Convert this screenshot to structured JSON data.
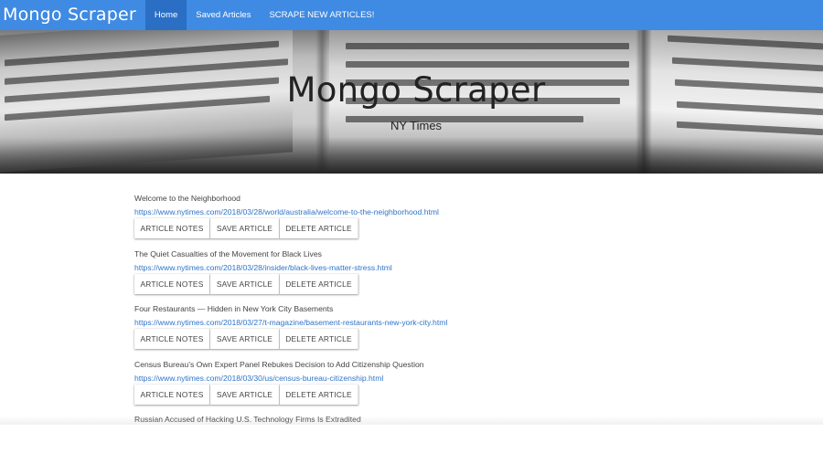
{
  "navbar": {
    "brand": "Mongo Scraper",
    "items": [
      {
        "label": "Home",
        "active": true
      },
      {
        "label": "Saved Articles",
        "active": false
      },
      {
        "label": "SCRAPE NEW ARTICLES!",
        "active": false
      }
    ],
    "color": "#3f8ae2",
    "active_color": "#2a6fc4"
  },
  "hero": {
    "title": "Mongo Scraper",
    "subtitle": "NY Times",
    "background": "newspaper-photo"
  },
  "buttons": {
    "notes": "ARTICLE NOTES",
    "save": "SAVE ARTICLE",
    "delete": "DELETE ARTICLE"
  },
  "articles": [
    {
      "title": "Welcome to the Neighborhood",
      "link": "https://www.nytimes.com/2018/03/28/world/australia/welcome-to-the-neighborhood.html"
    },
    {
      "title": "The Quiet Casualties of the Movement for Black Lives",
      "link": "https://www.nytimes.com/2018/03/28/insider/black-lives-matter-stress.html"
    },
    {
      "title": "Four Restaurants — Hidden in New York City Basements",
      "link": "https://www.nytimes.com/2018/03/27/t-magazine/basement-restaurants-new-york-city.html"
    },
    {
      "title": "Census Bureau’s Own Expert Panel Rebukes Decision to Add Citizenship Question",
      "link": "https://www.nytimes.com/2018/03/30/us/census-bureau-citizenship.html"
    },
    {
      "title": "Russian Accused of Hacking U.S. Technology Firms Is Extradited",
      "link": ""
    }
  ],
  "link_color": "#2f74c9"
}
